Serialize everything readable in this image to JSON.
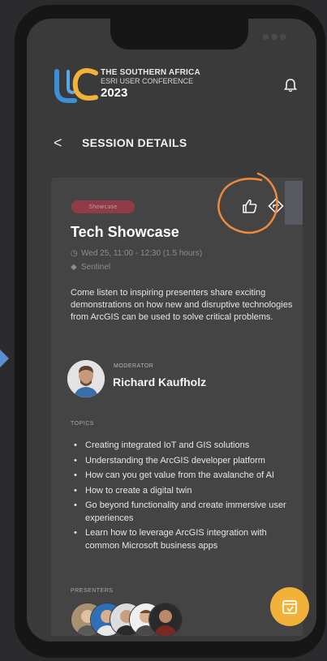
{
  "header": {
    "logo_line1": "THE SOUTHERN AFRICA",
    "logo_line2": "ESRI USER CONFERENCE",
    "logo_year": "2023",
    "bell_icon": "bell-icon"
  },
  "nav": {
    "back_icon": "chevron-left-icon",
    "back_glyph": "<",
    "title": "SESSION DETAILS"
  },
  "session": {
    "badge": "Showcase",
    "title": "Tech Showcase",
    "datetime": "Wed 25, 11:00 - 12:30 (1.5 hours)",
    "location": "Sentinel",
    "description": "Come listen to inspiring presenters share exciting demonstrations on how new and disruptive technologies from ArcGIS can be used to solve critical problems.",
    "like_icon": "thumbs-up-icon",
    "directions_icon": "directions-icon"
  },
  "moderator": {
    "label": "MODERATOR",
    "name": "Richard Kaufholz"
  },
  "topics": {
    "label": "TOPICS",
    "items": [
      "Creating integrated IoT and GIS solutions",
      "Understanding the ArcGIS developer platform",
      "How can you get value from the avalanche of AI",
      "How to create a digital twin",
      "Go beyond functionality and create immersive user experiences",
      "Learn how to leverage ArcGIS integration with common Microsoft business apps"
    ]
  },
  "presenters": {
    "label": "PRESENTERS",
    "count": 5
  },
  "fab": {
    "icon": "add-to-calendar-icon"
  },
  "colors": {
    "background": "#2b2b2d",
    "screen": "#3a3a3b",
    "card": "#444445",
    "badge": "#a83a4a",
    "annotation": "#f08a3a",
    "fab": "#f2b23a",
    "logo_blue": "#3a8fd8",
    "logo_gold": "#f2b23a"
  }
}
